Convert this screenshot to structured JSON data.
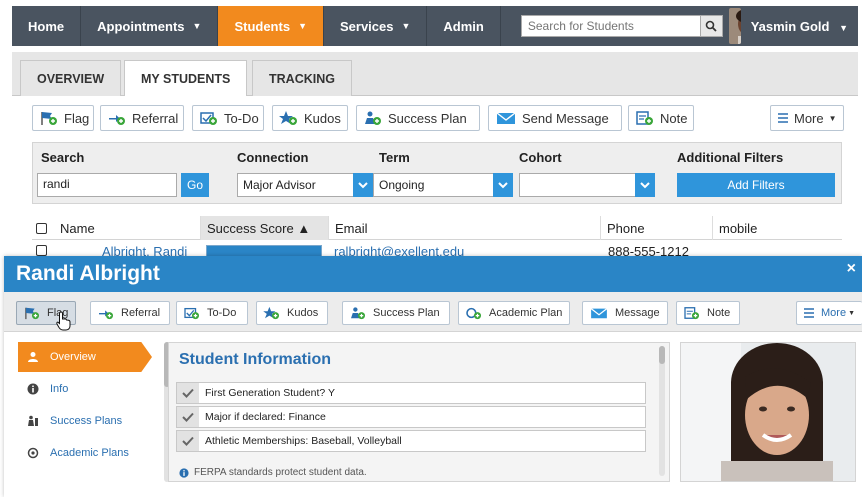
{
  "topnav": {
    "items": [
      {
        "label": "Home"
      },
      {
        "label": "Appointments",
        "dropdown": true
      },
      {
        "label": "Students",
        "dropdown": true,
        "active": true
      },
      {
        "label": "Services",
        "dropdown": true
      },
      {
        "label": "Admin"
      }
    ],
    "search_placeholder": "Search for Students",
    "user_name": "Yasmin Gold"
  },
  "tabs": [
    "OVERVIEW",
    "MY STUDENTS",
    "TRACKING"
  ],
  "actions": {
    "flag": "Flag",
    "referral": "Referral",
    "todo": "To-Do",
    "kudos": "Kudos",
    "success_plan": "Success Plan",
    "send_message": "Send Message",
    "note": "Note",
    "more": "More"
  },
  "filters": {
    "search_label": "Search",
    "search_value": "randi",
    "go_label": "Go",
    "connection_label": "Connection",
    "connection_value": "Major Advisor",
    "term_label": "Term",
    "term_value": "Ongoing",
    "cohort_label": "Cohort",
    "cohort_value": "",
    "additional_label": "Additional Filters",
    "add_filters_label": "Add Filters"
  },
  "table": {
    "columns": [
      "Name",
      "Success Score ▲",
      "Email",
      "Phone",
      "mobile"
    ],
    "row": {
      "name": "Albright, Randi",
      "email": "ralbright@exellent.edu",
      "phone": "888-555-1212"
    }
  },
  "modal": {
    "title": "Randi Albright",
    "close": "×",
    "actions": {
      "flag": "Flag",
      "referral": "Referral",
      "todo": "To-Do",
      "kudos": "Kudos",
      "success_plan": "Success Plan",
      "academic_plan": "Academic Plan",
      "message": "Message",
      "note": "Note",
      "more": "More"
    },
    "sidebar": [
      {
        "label": "Overview",
        "icon": "person-icon",
        "active": true
      },
      {
        "label": "Info",
        "icon": "info-icon"
      },
      {
        "label": "Success Plans",
        "icon": "plan-icon"
      },
      {
        "label": "Academic Plans",
        "icon": "academic-icon"
      }
    ],
    "info_title": "Student Information",
    "info_rows": [
      "First Generation Student? Y",
      "Major if declared: Finance",
      "Athletic Memberships: Baseball, Volleyball"
    ],
    "info_note": "FERPA standards protect student data."
  },
  "colors": {
    "nav_bg": "#4a5460",
    "active_orange": "#f28a1e",
    "modal_blue": "#2a85c6",
    "button_blue": "#2f95db",
    "link_blue": "#2a6fb0"
  }
}
